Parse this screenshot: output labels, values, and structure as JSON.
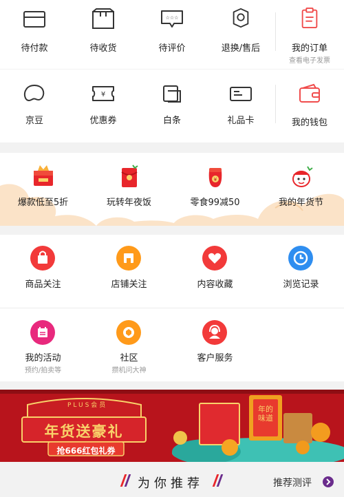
{
  "orders": {
    "items": [
      {
        "label": "待付款",
        "icon": "wallet-card-icon"
      },
      {
        "label": "待收货",
        "icon": "package-box-icon"
      },
      {
        "label": "待评价",
        "icon": "review-bubble-icon"
      },
      {
        "label": "退换/售后",
        "icon": "return-service-icon"
      }
    ],
    "my_orders": {
      "label": "我的订单",
      "sub": "查看电子发票",
      "icon": "order-document-icon"
    }
  },
  "wallet": {
    "items": [
      {
        "label": "京豆",
        "icon": "bean-icon"
      },
      {
        "label": "优惠券",
        "icon": "coupon-icon"
      },
      {
        "label": "白条",
        "icon": "baitiao-card-icon"
      },
      {
        "label": "礼品卡",
        "icon": "gift-card-icon"
      }
    ],
    "my_wallet": {
      "label": "我的钱包",
      "icon": "purse-icon"
    }
  },
  "promo": {
    "items": [
      {
        "label": "爆款低至5折",
        "icon": "hot-sale-box-icon"
      },
      {
        "label": "玩转年夜饭",
        "icon": "red-envelope-icon"
      },
      {
        "label": "零食99减50",
        "icon": "red-pouch-icon"
      },
      {
        "label": "我的年货节",
        "icon": "festival-mascot-icon"
      }
    ]
  },
  "follows": {
    "row1": [
      {
        "label": "商品关注",
        "icon": "shopping-bag-icon",
        "color": "#f23a3a"
      },
      {
        "label": "店铺关注",
        "icon": "store-icon",
        "color": "#ff9a1a"
      },
      {
        "label": "内容收藏",
        "icon": "heart-icon",
        "color": "#f23a3a"
      },
      {
        "label": "浏览记录",
        "icon": "clock-icon",
        "color": "#2f8ef0"
      }
    ],
    "row2": [
      {
        "label": "我的活动",
        "sub": "预约/拍卖等",
        "icon": "calendar-icon",
        "color": "#e8297d"
      },
      {
        "label": "社区",
        "sub": "攒机问大神",
        "icon": "community-shield-icon",
        "color": "#ff9a1a"
      },
      {
        "label": "客户服务",
        "sub": "",
        "icon": "customer-service-icon",
        "color": "#f23a3a"
      }
    ]
  },
  "banner": {
    "plus_text": "PLUS会员",
    "headline": "年货送豪礼",
    "subline": "抢666红包礼券",
    "package_text": "年的味道",
    "bg_color": "#b8141c",
    "gold_color": "#f9d26a"
  },
  "recommend": {
    "title": "为你推荐",
    "link": "推荐测评",
    "accent_color": "#6a2c8c"
  }
}
